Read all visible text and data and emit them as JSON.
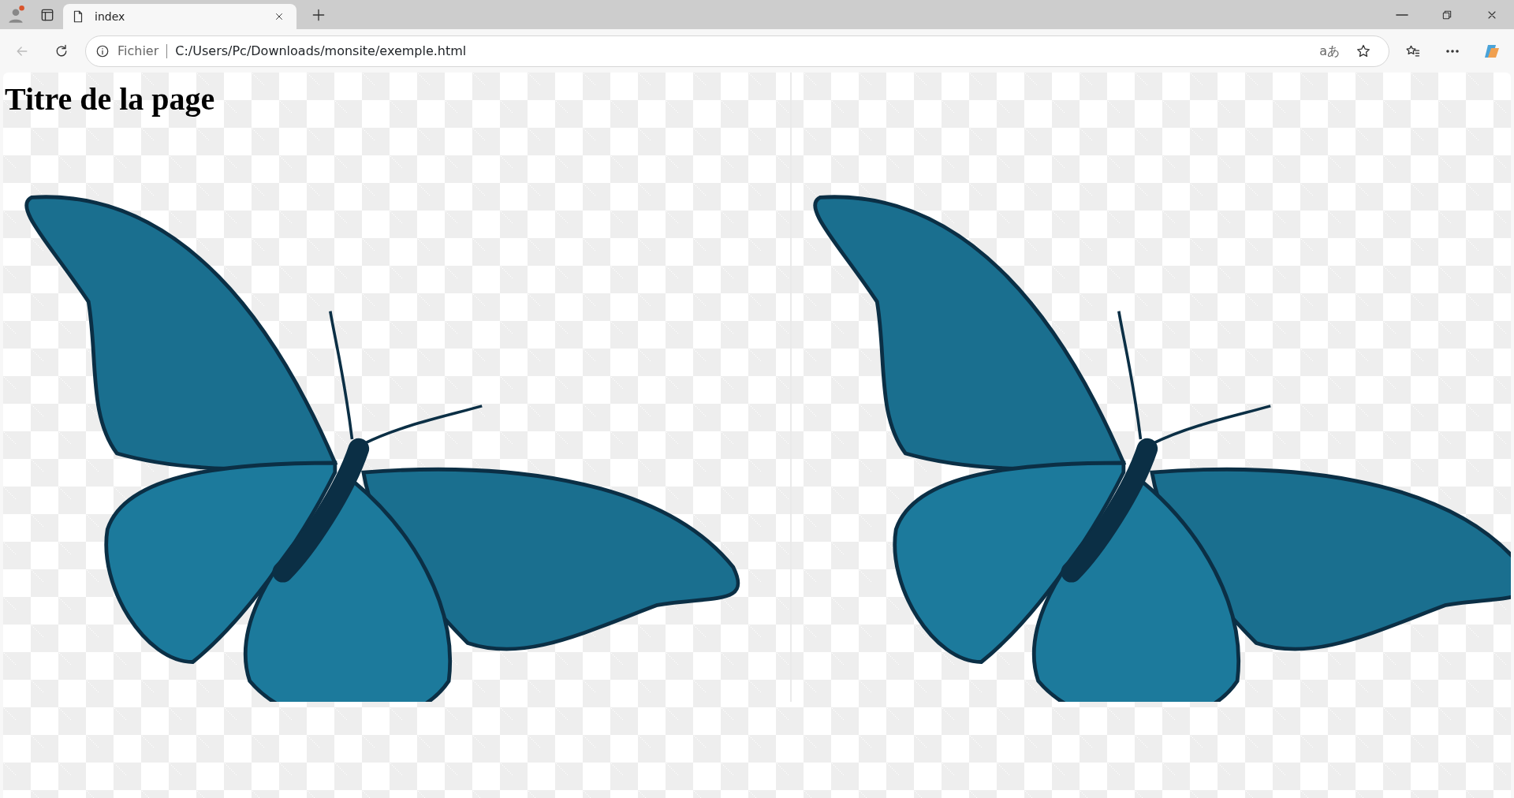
{
  "browser": {
    "tabs": [
      {
        "title": "index",
        "selected": true
      }
    ],
    "address_bar": {
      "security_label": "Fichier",
      "url": "C:/Users/Pc/Downloads/monsite/exemple.html"
    },
    "translate_label": "aあ"
  },
  "page": {
    "heading": "Titre de la page",
    "images": [
      {
        "kind": "butterfly"
      },
      {
        "kind": "butterfly"
      }
    ]
  }
}
